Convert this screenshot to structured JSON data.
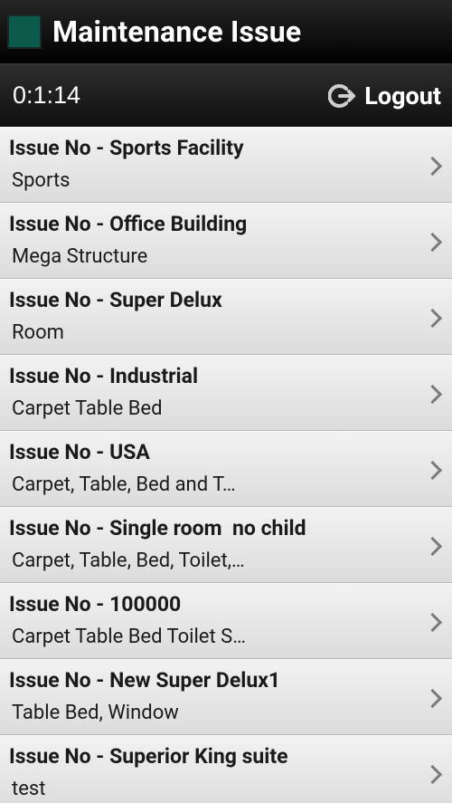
{
  "header": {
    "title": "Maintenance Issue",
    "icon_color": "#0b5a4c"
  },
  "subheader": {
    "timer": "0:1:14",
    "logout_label": "Logout"
  },
  "issues": [
    {
      "title": "Issue No - Sports Facility",
      "subtitle": "Sports"
    },
    {
      "title": "Issue No - Office Building",
      "subtitle": "Mega Structure"
    },
    {
      "title": "Issue No - Super Delux",
      "subtitle": "Room"
    },
    {
      "title": "Issue No - Industrial",
      "subtitle": "Carpet Table Bed"
    },
    {
      "title": "Issue No - USA",
      "subtitle": "Carpet, Table, Bed and T…"
    },
    {
      "title": "Issue No - Single room  no child",
      "subtitle": "Carpet, Table, Bed, Toilet,…"
    },
    {
      "title": "Issue No - 100000",
      "subtitle": "Carpet Table Bed Toilet S…"
    },
    {
      "title": "Issue No - New Super Delux1",
      "subtitle": "Table Bed, Window"
    },
    {
      "title": "Issue No - Superior King suite",
      "subtitle": "test"
    }
  ]
}
